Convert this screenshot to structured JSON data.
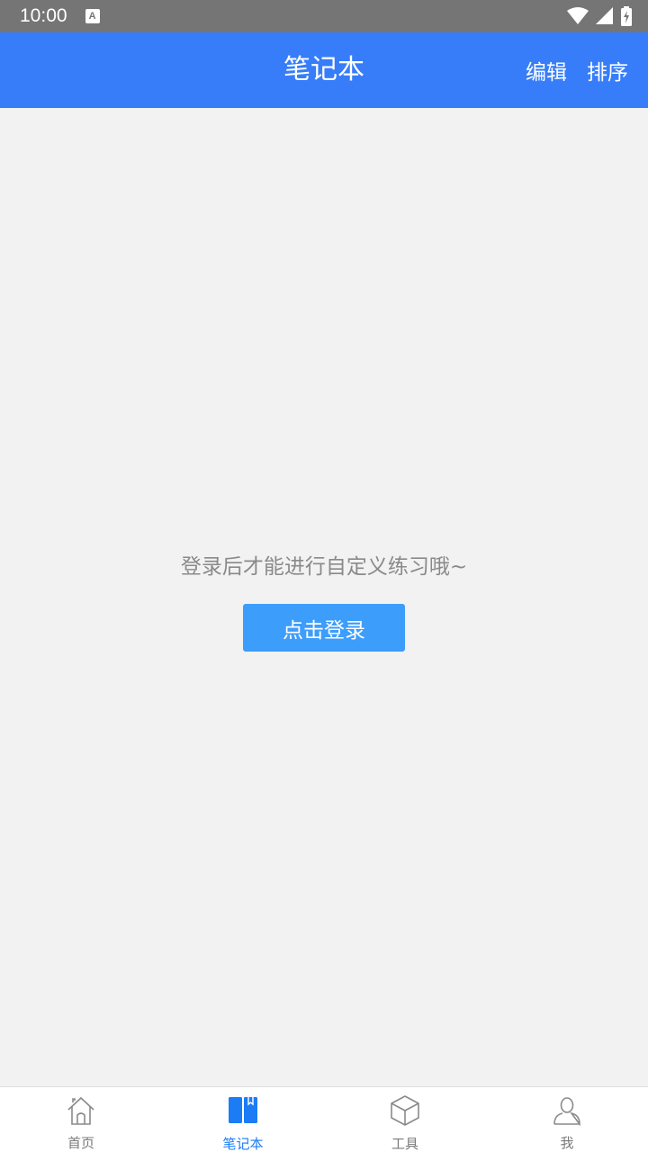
{
  "status_bar": {
    "time": "10:00",
    "badge_letter": "A"
  },
  "header": {
    "title": "笔记本",
    "edit_label": "编辑",
    "sort_label": "排序",
    "background_color": "#377df9"
  },
  "main": {
    "empty_message": "登录后才能进行自定义练习哦~",
    "login_button_label": "点击登录",
    "button_color": "#3d9dfb"
  },
  "tabs": [
    {
      "label": "首页",
      "icon": "home-icon",
      "active": false
    },
    {
      "label": "笔记本",
      "icon": "notebook-icon",
      "active": true
    },
    {
      "label": "工具",
      "icon": "box-icon",
      "active": false
    },
    {
      "label": "我",
      "icon": "user-icon",
      "active": false
    }
  ],
  "colors": {
    "active_tab": "#1b7cf5",
    "inactive_tab": "#7a7a7a"
  }
}
